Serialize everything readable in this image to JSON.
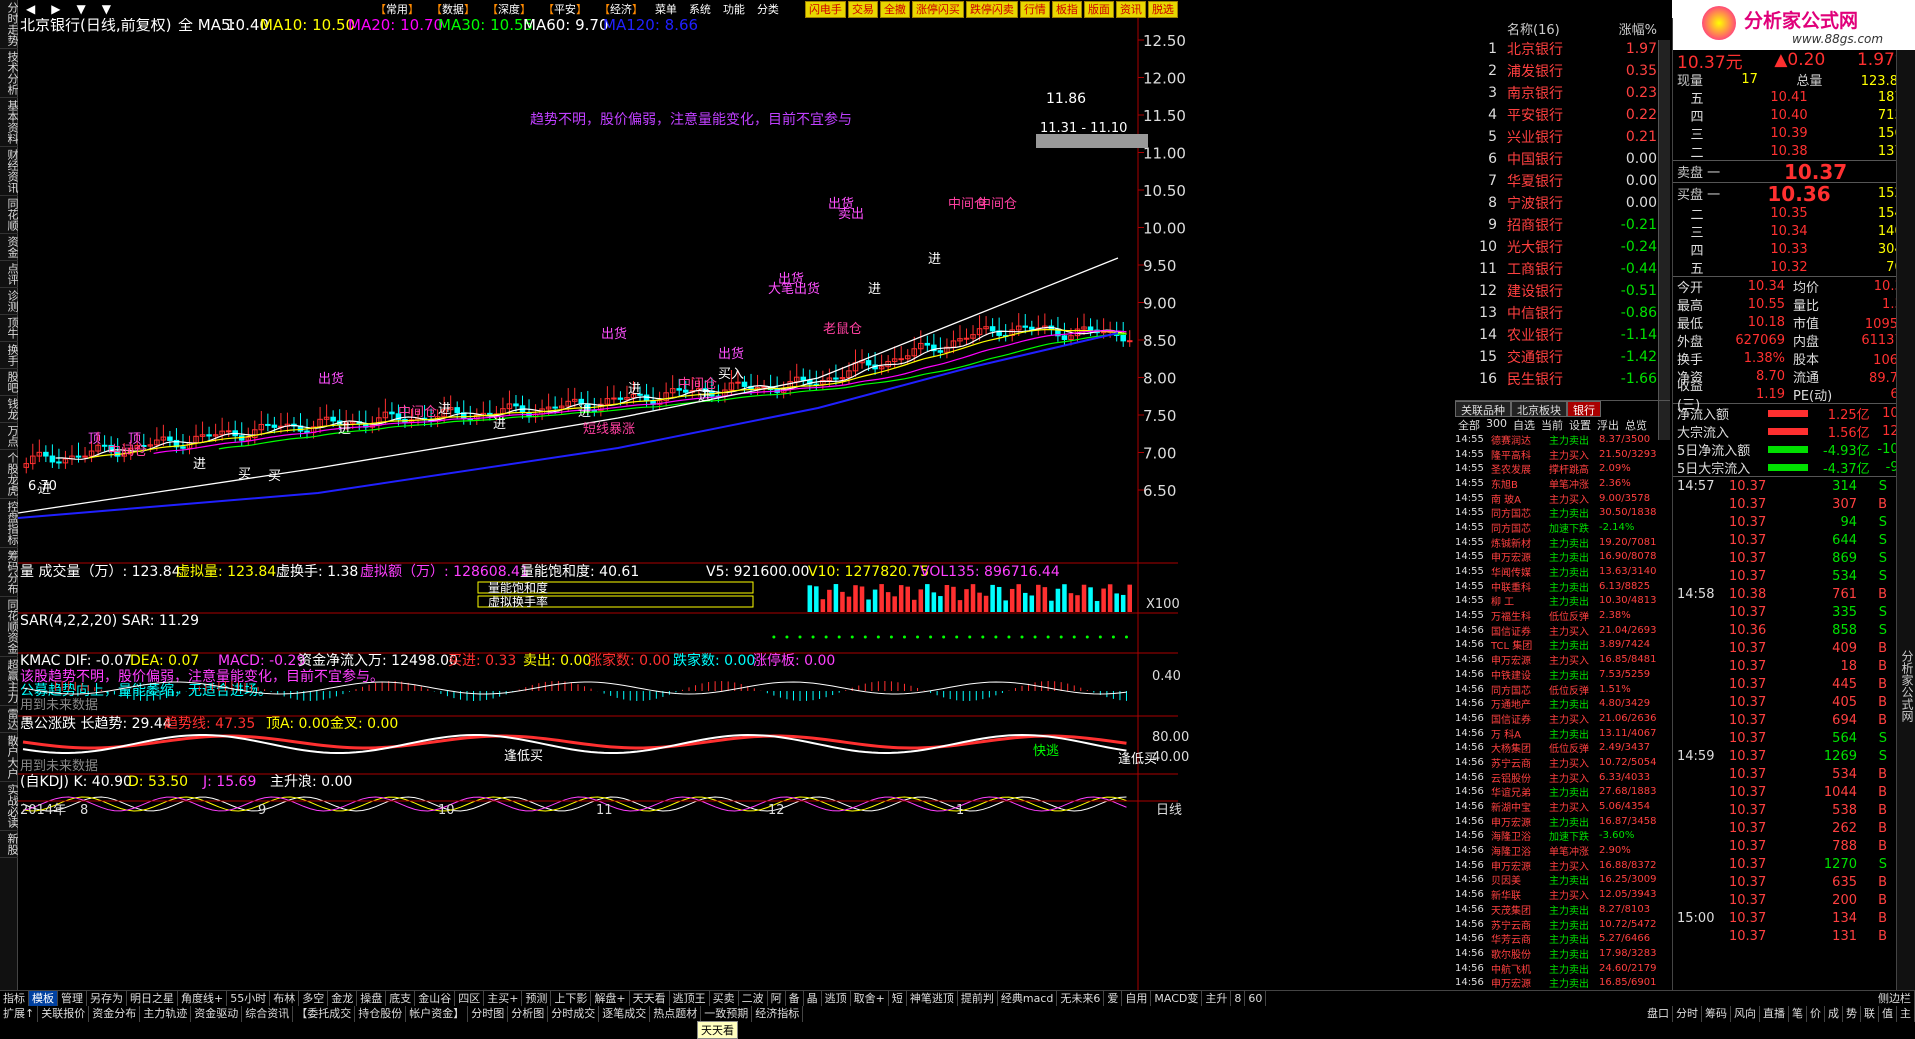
{
  "app": {
    "title": "北京银行(日线,前复权)",
    "logo": "分析家公式网",
    "logo_url": "www.88gs.com"
  },
  "menu": {
    "nav": [
      "◀",
      "▶",
      "▼",
      "▼"
    ],
    "items": [
      "常用",
      "数据",
      "深度",
      "平安",
      "经济"
    ],
    "plain": [
      "菜单",
      "系统",
      "功能",
      "分类"
    ],
    "tools": [
      "闪电手",
      "交易",
      "全撤",
      "涨停闪买",
      "跌停闪卖",
      "行情",
      "板指",
      "版面",
      "资讯",
      "脱选"
    ]
  },
  "leftbar": [
    "分时走势",
    "技术分析",
    "基本资料",
    "财经资讯",
    "同花顺",
    "资金",
    "点评",
    "诊测",
    "顶牛",
    "换手",
    "股吧",
    "钱龙",
    "万点",
    "个股龙虎",
    "控盘指标",
    "筹码分布",
    "同花顺资金",
    "超赢主力",
    "雷达",
    "散户大户",
    "实战必读",
    "新股"
  ],
  "ma_line": {
    "label": "全 MA5:",
    "ma5": "10.40",
    "ma10": "MA10: 10.50",
    "ma20": "MA20: 10.70",
    "ma30": "MA30: 10.55",
    "ma60": "MA60: 9.70",
    "ma120": "MA120: 8.66"
  },
  "colors": {
    "ma5": "#ffffff",
    "ma10": "#ffff00",
    "ma20": "#ff00ff",
    "ma30": "#00ff00",
    "ma60": "#ffffff",
    "ma120": "#2020ff",
    "up": "#ff3030",
    "down": "#00ffff"
  },
  "price_axis": [
    "12.50",
    "12.00",
    "11.50",
    "11.00",
    "10.50",
    "10.00",
    "9.50",
    "9.00",
    "8.50",
    "8.00",
    "7.50",
    "7.00",
    "6.50"
  ],
  "annotations": {
    "trend": "趋势不明，股价偏弱，注意量能变化，目前不宜参与",
    "high": "11.86",
    "range": "11.31 - 11.10",
    "low": "6.70",
    "labels": [
      "出货",
      "出货",
      "出货",
      "出货",
      "出货",
      "卖出",
      "中间仓",
      "中间仓",
      "中间仓",
      "中间仓",
      "中间仓",
      "买入",
      "进",
      "进",
      "进",
      "进",
      "进",
      "进",
      "进",
      "进",
      "进",
      "顶",
      "顶",
      "买",
      "买",
      "短线暴涨",
      "大笔出货",
      "老鼠仓",
      "进"
    ]
  },
  "volume": {
    "title": "量 成交量（万）: 123.84",
    "virt": "虚拟量: 123.84",
    "turn": "虚换手: 1.38",
    "amt": "虚拟额（万）: 128608.41",
    "sat": "量能饱和度: 40.61",
    "v5": "V5: 921600.00",
    "v10": "V10: 1277820.75",
    "v135": "VOL135: 896716.44",
    "box1": "量能饱和度",
    "box2": "虚拟换手率",
    "x100": "X100"
  },
  "sar": {
    "title": "SAR(4,2,2,20) SAR: 11.29"
  },
  "kmac": {
    "title": "KMAC DIF: -0.07",
    "dea": "DEA: 0.07",
    "macd": "MACD: -0.29",
    "flow": "资金净流入万: 12498.00",
    "buy": "买进: 0.33",
    "sell": "卖出: 0.00",
    "up": "涨家数: 0.00",
    "down": "跌家数: 0.00",
    "limit": "涨停板: 0.00",
    "msg1": "该股趋势不明，股价偏弱，注意量能变化，目前不宜参与。",
    "msg2": "公募趋势向上，量能萎缩，无适合进场。",
    "future": "用到未来数据",
    "axis": "0.40"
  },
  "trendpane": {
    "title": "愚公涨跌 长趋势: 29.44",
    "line": "趋势线: 47.35",
    "top": "顶A: 0.00",
    "gold": "金叉: 0.00",
    "future": "用到未来数据",
    "low1": "逢低买",
    "low2": "逢低买",
    "run": "快逃",
    "axis1": "80.00",
    "axis2": "40.00"
  },
  "kdj": {
    "title": "(自KDJ) K: 40.90",
    "d": "D: 53.50",
    "j": "J: 15.69",
    "main": "主升浪: 0.00"
  },
  "dates": [
    "2014年",
    "8",
    "9",
    "10",
    "11",
    "12",
    "1"
  ],
  "period": "日线",
  "watchlist": {
    "header": [
      "名称(16)",
      "涨幅%"
    ],
    "items": [
      {
        "n": "1",
        "name": "北京银行",
        "pct": "1.97"
      },
      {
        "n": "2",
        "name": "浦发银行",
        "pct": "0.35"
      },
      {
        "n": "3",
        "name": "南京银行",
        "pct": "0.23"
      },
      {
        "n": "4",
        "name": "平安银行",
        "pct": "0.22"
      },
      {
        "n": "5",
        "name": "兴业银行",
        "pct": "0.21"
      },
      {
        "n": "6",
        "name": "中国银行",
        "pct": "0.00"
      },
      {
        "n": "7",
        "name": "华夏银行",
        "pct": "0.00"
      },
      {
        "n": "8",
        "name": "宁波银行",
        "pct": "0.00"
      },
      {
        "n": "9",
        "name": "招商银行",
        "pct": "-0.21"
      },
      {
        "n": "10",
        "name": "光大银行",
        "pct": "-0.24"
      },
      {
        "n": "11",
        "name": "工商银行",
        "pct": "-0.44"
      },
      {
        "n": "12",
        "name": "建设银行",
        "pct": "-0.51"
      },
      {
        "n": "13",
        "name": "中信银行",
        "pct": "-0.86"
      },
      {
        "n": "14",
        "name": "农业银行",
        "pct": "-1.14"
      },
      {
        "n": "15",
        "name": "交通银行",
        "pct": "-1.42"
      },
      {
        "n": "16",
        "name": "民生银行",
        "pct": "-1.66"
      }
    ]
  },
  "quote": {
    "price": "10.37元",
    "chg": "▲0.20",
    "chgpct": "1.97%",
    "now": "现量",
    "nowv": "17",
    "total": "总量",
    "totalv": "123.8万",
    "sells": [
      {
        "l": "五",
        "p": "10.41",
        "v": "1870"
      },
      {
        "l": "四",
        "p": "10.40",
        "v": "7137"
      },
      {
        "l": "三",
        "p": "10.39",
        "v": "1568"
      },
      {
        "l": "二",
        "p": "10.38",
        "v": "1378"
      }
    ],
    "sell1": {
      "l": "卖盘 一",
      "p": "10.37"
    },
    "buy1": {
      "l": "买盘 一",
      "p": "10.36",
      "v": "1522"
    },
    "buys": [
      {
        "l": "二",
        "p": "10.35",
        "v": "1549"
      },
      {
        "l": "三",
        "p": "10.34",
        "v": "1402"
      },
      {
        "l": "四",
        "p": "10.33",
        "v": "3043"
      },
      {
        "l": "五",
        "p": "10.32",
        "v": "703"
      }
    ],
    "stats": [
      [
        "今开",
        "10.34",
        "均价",
        "10.38"
      ],
      [
        "最高",
        "10.55",
        "量比",
        "1.32"
      ],
      [
        "最低",
        "10.18",
        "市值",
        "1095亿"
      ],
      [
        "外盘",
        "627069",
        "内盘",
        "611370"
      ],
      [
        "换手",
        "1.38%",
        "股本",
        "106亿"
      ],
      [
        "净资",
        "8.70",
        "流通",
        "89.7亿"
      ],
      [
        "收益(三)",
        "1.19",
        "PE(动)",
        "6.5"
      ]
    ],
    "flows": [
      [
        "净流入额",
        "1.25亿",
        "10%"
      ],
      [
        "大宗流入",
        "1.56亿",
        "12%"
      ],
      [
        "5日净流入额",
        "-4.93亿",
        "-10%"
      ],
      [
        "5日大宗流入",
        "-4.37亿",
        "-9%"
      ]
    ]
  },
  "related": {
    "tabs": [
      "关联品种",
      "北京板块",
      "银行"
    ],
    "sub": [
      "全部",
      "300",
      "自选",
      "当前",
      "设置",
      "浮出",
      "总览"
    ]
  },
  "ticks": [
    [
      "14:55",
      "德赛润达",
      "主力卖出",
      "8.37/3500"
    ],
    [
      "14:55",
      "隆平高科",
      "主力买入",
      "21.50/3293"
    ],
    [
      "14:55",
      "圣农发展",
      "撑杆跳高",
      "2.09%"
    ],
    [
      "14:55",
      "东旭B",
      "单笔冲涨",
      "2.36%"
    ],
    [
      "14:55",
      "南 玻A",
      "主力买入",
      "9.00/3578"
    ],
    [
      "14:55",
      "同方国芯",
      "主力卖出",
      "30.50/1838"
    ],
    [
      "14:55",
      "同方国芯",
      "加速下跌",
      "-2.14%"
    ],
    [
      "14:55",
      "炼铖新材",
      "主力卖出",
      "19.20/7081"
    ],
    [
      "14:55",
      "申万宏源",
      "主力卖出",
      "16.90/8078"
    ],
    [
      "14:55",
      "华闻传媒",
      "主力卖出",
      "13.63/3140"
    ],
    [
      "14:55",
      "中联重科",
      "主力卖出",
      "6.13/8825"
    ],
    [
      "14:55",
      "柳 工",
      "主力卖出",
      "10.30/4813"
    ],
    [
      "14:55",
      "万福生科",
      "低位反弹",
      "2.38%"
    ],
    [
      "14:56",
      "国信证券",
      "主力买入",
      "21.04/2693"
    ],
    [
      "14:56",
      "TCL 集团",
      "主力卖出",
      "3.89/7424"
    ],
    [
      "14:56",
      "申万宏源",
      "主力买入",
      "16.85/8481"
    ],
    [
      "14:56",
      "中铁建设",
      "主力卖出",
      "7.53/5259"
    ],
    [
      "14:56",
      "同方国芯",
      "低位反弹",
      "1.51%"
    ],
    [
      "14:56",
      "万通地产",
      "主力卖出",
      "4.80/3429"
    ],
    [
      "14:56",
      "国信证券",
      "主力买入",
      "21.06/2636"
    ],
    [
      "14:56",
      "万 科A",
      "主力卖出",
      "13.11/4067"
    ],
    [
      "14:56",
      "大杨集团",
      "低位反弹",
      "2.49/3437"
    ],
    [
      "14:56",
      "苏宁云商",
      "主力买入",
      "10.72/5054"
    ],
    [
      "14:56",
      "云铝股份",
      "主力买入",
      "6.33/4033"
    ],
    [
      "14:56",
      "华谊兄弟",
      "主力卖出",
      "27.68/1883"
    ],
    [
      "14:56",
      "新湖中宝",
      "主力买入",
      "5.06/4354"
    ],
    [
      "14:56",
      "申万宏源",
      "主力卖出",
      "16.87/3458"
    ],
    [
      "14:56",
      "海隆卫浴",
      "加速下跌",
      "-3.60%"
    ],
    [
      "14:56",
      "海隆卫浴",
      "单笔冲涨",
      "2.90%"
    ],
    [
      "14:56",
      "申万宏源",
      "主力买入",
      "16.88/8372"
    ],
    [
      "14:56",
      "贝因美",
      "主力卖出",
      "16.25/3009"
    ],
    [
      "14:56",
      "新华联",
      "主力买入",
      "12.05/3943"
    ],
    [
      "14:56",
      "天茂集团",
      "主力卖出",
      "8.27/8103"
    ],
    [
      "14:56",
      "苏宁云商",
      "主力卖出",
      "10.72/5472"
    ],
    [
      "14:56",
      "华芳云商",
      "主力卖出",
      "5.27/6466"
    ],
    [
      "14:56",
      "歌尔股份",
      "主力卖出",
      "17.98/3283"
    ],
    [
      "14:56",
      "中航飞机",
      "主力卖出",
      "24.60/2179"
    ],
    [
      "14:56",
      "申万宏源",
      "主力卖出",
      "16.85/6901"
    ]
  ],
  "trades": [
    {
      "t": "14:57",
      "p": "10.37",
      "v": "314",
      "bs": "S"
    },
    {
      "t": "",
      "p": "10.37",
      "v": "307",
      "bs": "B"
    },
    {
      "t": "",
      "p": "10.37",
      "v": "94",
      "bs": "S"
    },
    {
      "t": "",
      "p": "10.37",
      "v": "644",
      "bs": "S"
    },
    {
      "t": "",
      "p": "10.37",
      "v": "869",
      "bs": "S"
    },
    {
      "t": "",
      "p": "10.37",
      "v": "534",
      "bs": "S"
    },
    {
      "t": "14:58",
      "p": "10.38",
      "v": "761",
      "bs": "B"
    },
    {
      "t": "",
      "p": "10.37",
      "v": "335",
      "bs": "S"
    },
    {
      "t": "",
      "p": "10.36",
      "v": "858",
      "bs": "S"
    },
    {
      "t": "",
      "p": "10.37",
      "v": "409",
      "bs": "B"
    },
    {
      "t": "",
      "p": "10.37",
      "v": "18",
      "bs": "B"
    },
    {
      "t": "",
      "p": "10.37",
      "v": "445",
      "bs": "B"
    },
    {
      "t": "",
      "p": "10.37",
      "v": "405",
      "bs": "B"
    },
    {
      "t": "",
      "p": "10.37",
      "v": "694",
      "bs": "B"
    },
    {
      "t": "",
      "p": "10.37",
      "v": "564",
      "bs": "S"
    },
    {
      "t": "14:59",
      "p": "10.37",
      "v": "1269",
      "bs": "S"
    },
    {
      "t": "",
      "p": "10.37",
      "v": "534",
      "bs": "B"
    },
    {
      "t": "",
      "p": "10.37",
      "v": "1044",
      "bs": "B"
    },
    {
      "t": "",
      "p": "10.37",
      "v": "538",
      "bs": "B"
    },
    {
      "t": "",
      "p": "10.37",
      "v": "262",
      "bs": "B"
    },
    {
      "t": "",
      "p": "10.37",
      "v": "788",
      "bs": "B"
    },
    {
      "t": "",
      "p": "10.37",
      "v": "1270",
      "bs": "S"
    },
    {
      "t": "",
      "p": "10.37",
      "v": "635",
      "bs": "B"
    },
    {
      "t": "",
      "p": "10.37",
      "v": "200",
      "bs": "B"
    },
    {
      "t": "15:00",
      "p": "10.37",
      "v": "134",
      "bs": "B"
    },
    {
      "t": "",
      "p": "10.37",
      "v": "131",
      "bs": "B"
    }
  ],
  "sidelabels": [
    "分析家公式网"
  ],
  "bottom": {
    "row1": [
      "指标",
      "模板",
      "管理",
      "另存为",
      "明日之星",
      "角度线+",
      "55小时",
      "布林",
      "多空",
      "金龙",
      "操盘",
      "底支",
      "金山谷",
      "四区",
      "主买+",
      "预测",
      "上下影",
      "解盘+",
      "天天看",
      "逃顶王",
      "买卖",
      "二波",
      "阿",
      "备",
      "晶",
      "逃顶",
      "取舍+",
      "短",
      "神笔逃顶",
      "提前判",
      "经典macd",
      "无未来6",
      "爱",
      "自用",
      "MACD变",
      "主升",
      "8",
      "60"
    ],
    "row2": [
      "扩展↑",
      "关联报价",
      "资金分布",
      "主力轨迹",
      "资金驱动",
      "综合资讯",
      "【委托成交",
      "持仓股份",
      "帐户资金】",
      "分时图",
      "分析图",
      "分时成交",
      "逐笔成交",
      "热点题材",
      "一致预期",
      "经济指标"
    ],
    "right1": [
      "侧边栏",
      "<>"
    ],
    "right2": [
      "盘口",
      "分时",
      "筹码",
      "风向",
      "直播",
      "笔",
      "价",
      "成",
      "势",
      "联",
      "值",
      "主"
    ],
    "tip": "天天看"
  }
}
